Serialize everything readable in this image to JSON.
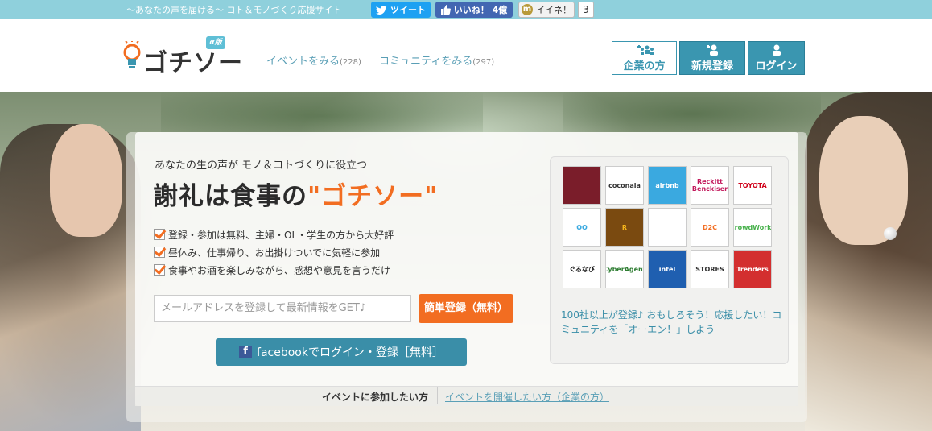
{
  "topbar": {
    "tagline": "〜あなたの声を届ける〜 コト＆モノづくり応援サイト",
    "tweet_label": "ツイート",
    "like_label": "いいね！ 4億",
    "iine_label": "イイネ！",
    "iine_count": "3"
  },
  "header": {
    "logo_text": "ゴチソー",
    "beta_label": "α版",
    "nav": [
      {
        "label": "イベントをみる",
        "count": "(228)"
      },
      {
        "label": "コミュニティをみる",
        "count": "(297)"
      }
    ],
    "buttons": {
      "company": "企業の方",
      "register": "新規登録",
      "login": "ログイン"
    }
  },
  "hero": {
    "lead": "あなたの生の声が モノ＆コトづくりに役立つ",
    "headline_pre": "謝礼は食事の",
    "headline_hl": "\"ゴチソー\"",
    "checks": [
      "登録・参加は無料、主婦・OL・学生の方から大好評",
      "昼休み、仕事帰り、お出掛けついでに気軽に参加",
      "食事やお酒を楽しみながら、感想や意見を言うだけ"
    ],
    "email_placeholder": "メールアドレスを登録して最新情報をGET♪",
    "signup_label": "簡単登録（無料）",
    "fb_label": "facebookでログイン・登録［無料］",
    "tab_participant": "イベントに参加したい方",
    "tab_host": "イベントを開催したい方（企業の方）"
  },
  "logos": {
    "tiles": [
      {
        "name": "camera",
        "text": "",
        "bg": "#7a1d2a",
        "fg": "#fff"
      },
      {
        "name": "coconala",
        "text": "coconala",
        "bg": "#fff",
        "fg": "#333"
      },
      {
        "name": "airbnb",
        "text": "airbnb",
        "bg": "#3aa9e0",
        "fg": "#fff"
      },
      {
        "name": "reckitt",
        "text": "Reckitt Benckiser",
        "bg": "#fff",
        "fg": "#c2185b"
      },
      {
        "name": "toyota",
        "text": "TOYOTA",
        "bg": "#fff",
        "fg": "#d0021b"
      },
      {
        "name": "oo",
        "text": "OO",
        "bg": "#fff",
        "fg": "#3aa9e0"
      },
      {
        "name": "r",
        "text": "R",
        "bg": "#7a4a10",
        "fg": "#f5b51b"
      },
      {
        "name": "square",
        "text": "",
        "bg": "#fff",
        "fg": "#111"
      },
      {
        "name": "d2c",
        "text": "D2C",
        "bg": "#fff",
        "fg": "#f26d21"
      },
      {
        "name": "crowdworks",
        "text": "CrowdWorks",
        "bg": "#fff",
        "fg": "#46b04a"
      },
      {
        "name": "gurunavi",
        "text": "ぐるなび",
        "bg": "#fff",
        "fg": "#111"
      },
      {
        "name": "cyberagent",
        "text": "CyberAgent",
        "bg": "#fff",
        "fg": "#2e7d32"
      },
      {
        "name": "intel",
        "text": "intel",
        "bg": "#1f5fb0",
        "fg": "#fff"
      },
      {
        "name": "stores",
        "text": "STORES",
        "bg": "#fff",
        "fg": "#333"
      },
      {
        "name": "trenders",
        "text": "Trenders",
        "bg": "#d32f2f",
        "fg": "#fff"
      }
    ],
    "caption": "100社以上が登録♪ おもしろそう！応援したい！コミュニティを「オーエン！」しよう"
  }
}
